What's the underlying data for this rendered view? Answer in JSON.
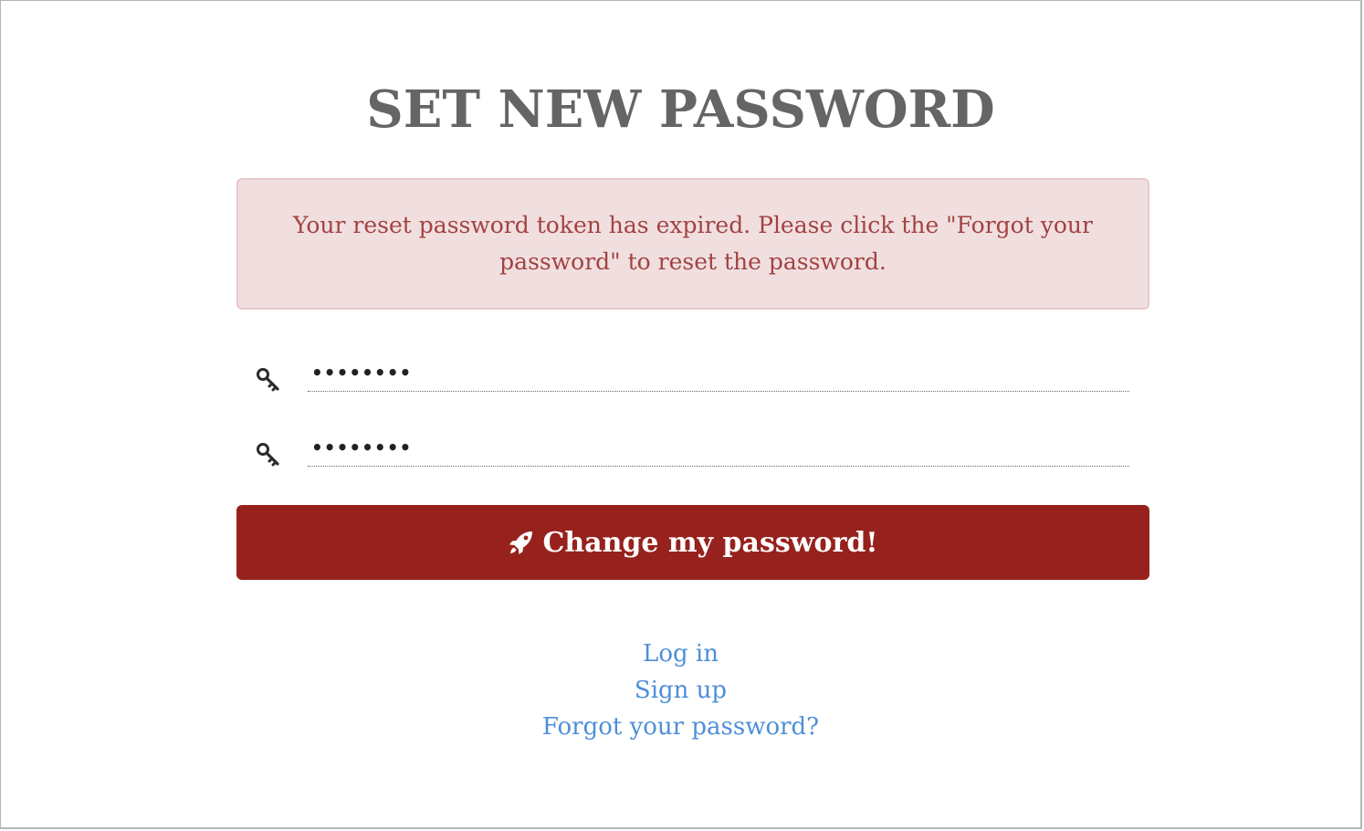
{
  "page": {
    "title": "SET NEW PASSWORD"
  },
  "alert": {
    "message": "Your reset password token has expired. Please click the \"Forgot your password\" to reset the password."
  },
  "form": {
    "password": {
      "value": "password",
      "icon": "key-icon"
    },
    "password_confirmation": {
      "value": "password",
      "icon": "key-icon"
    },
    "submit": {
      "label": "Change my password!",
      "icon": "rocket-icon"
    }
  },
  "links": {
    "login": "Log in",
    "signup": "Sign up",
    "forgot": "Forgot your password?"
  },
  "colors": {
    "title": "#656565",
    "alert_bg": "#f1dfe0",
    "alert_border": "#e8c8cc",
    "alert_text": "#a24342",
    "button_bg": "#97221d",
    "link": "#4f8fd8"
  }
}
